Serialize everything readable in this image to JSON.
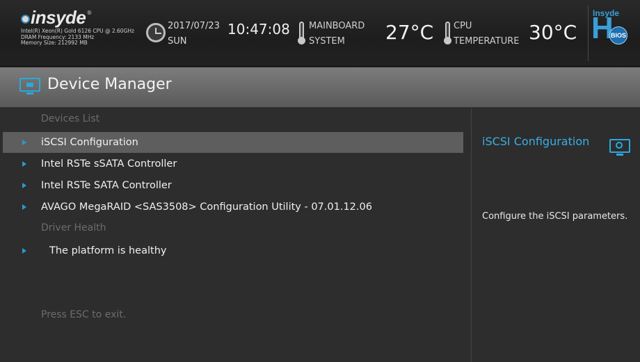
{
  "header": {
    "logo_text": "insyde",
    "logo_reg": "®",
    "cpu_info": "Intel(R) Xeon(R) Gold 6126 CPU @ 2.60GHz",
    "dram_frequency": "DRAM Frequency: 2133 MHz",
    "memory_size": "Memory Size: 212992 MB",
    "date": "2017/07/23",
    "weekday": "SUN",
    "time": "10:47:08",
    "mainboard_label_1": "MAINBOARD",
    "mainboard_label_2": "SYSTEM",
    "mainboard_temp": "27°C",
    "cpu_label_1": "CPU",
    "cpu_label_2": "TEMPERATURE",
    "cpu_temp": "30°C",
    "h2o_small": "Insyde",
    "h2o_letter": "H",
    "h2o_badge": "BIOS"
  },
  "title": "Device Manager",
  "menu": {
    "section_devices": "Devices List",
    "items": [
      {
        "label": "iSCSI Configuration",
        "selected": true
      },
      {
        "label": "Intel RSTe sSATA Controller",
        "selected": false
      },
      {
        "label": "Intel RSTe SATA Controller",
        "selected": false
      },
      {
        "label": "AVAGO MegaRAID <SAS3508> Configuration Utility - 07.01.12.06",
        "selected": false
      }
    ],
    "section_driver_health": "Driver Health",
    "health_item": "The platform is healthy",
    "footer_hint": "Press ESC to exit."
  },
  "help": {
    "title": "iSCSI Configuration",
    "description": "Configure the iSCSI parameters."
  },
  "colors": {
    "accent": "#2f97cf",
    "selected_row": "#5e5e5e",
    "dim_text": "#6c6c6c"
  }
}
